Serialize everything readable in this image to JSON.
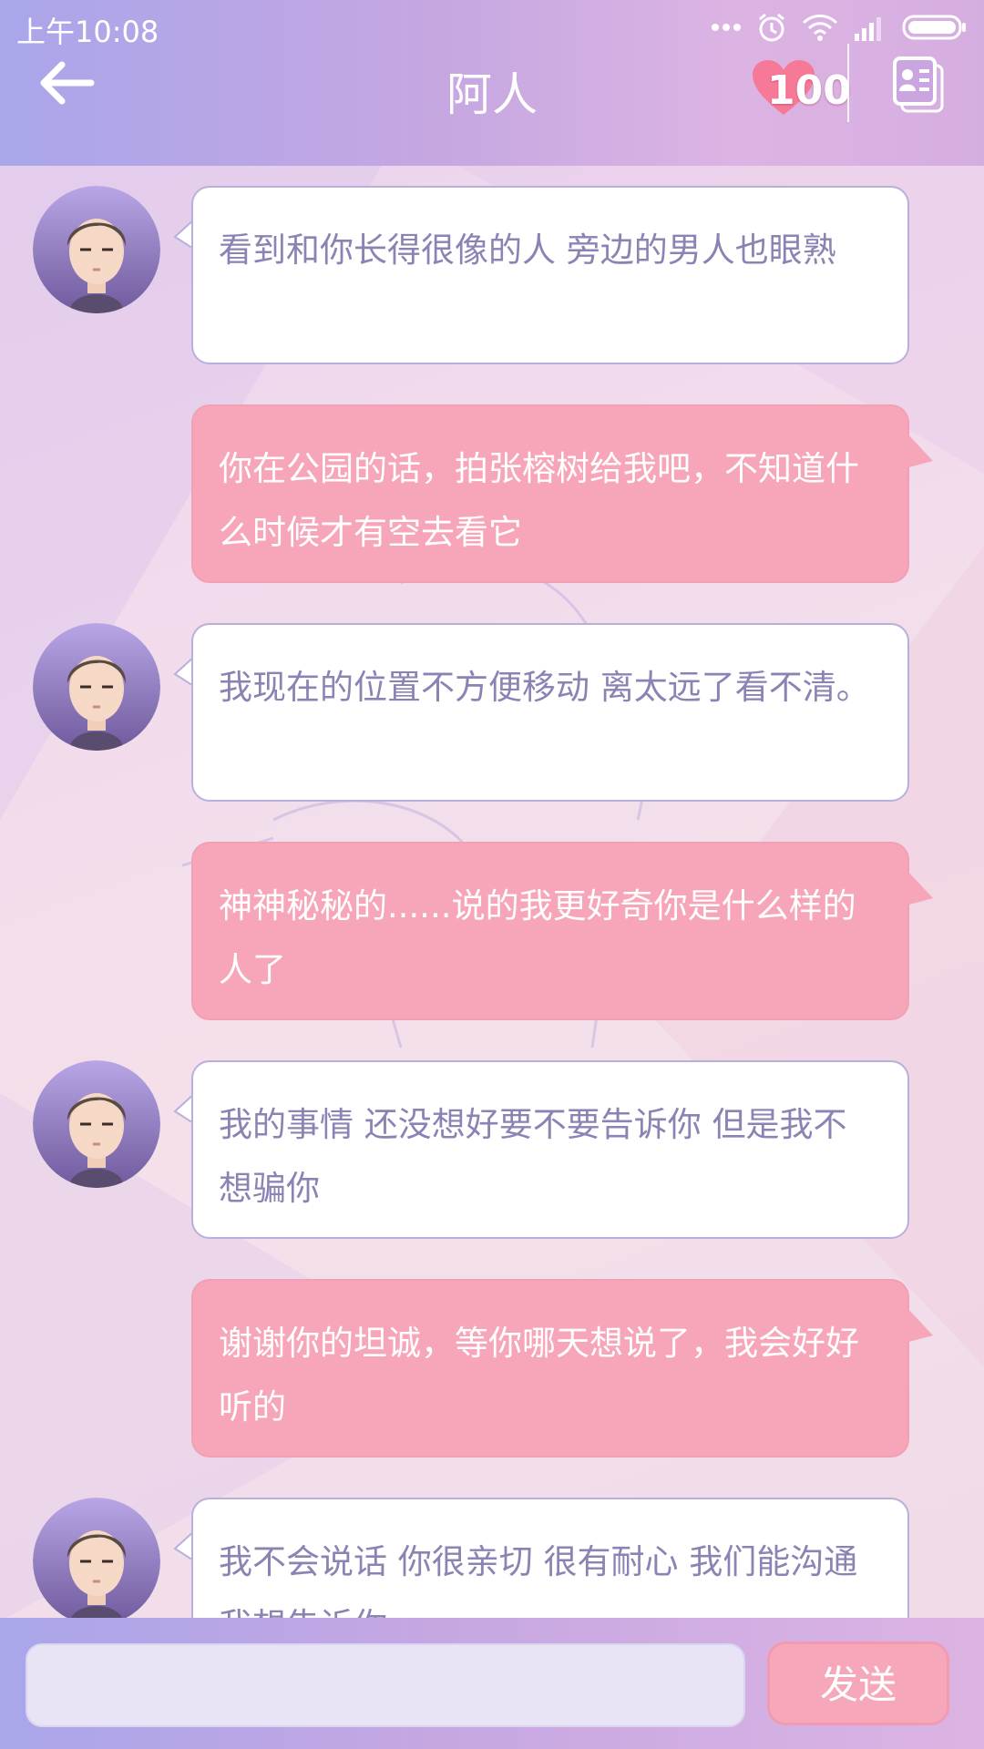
{
  "status_bar": {
    "time": "上午10:08",
    "icons": [
      "more-dots-icon",
      "alarm-icon",
      "wifi-icon",
      "signal-icon",
      "battery-icon"
    ]
  },
  "header": {
    "title": "阿人",
    "back_icon": "back-arrow-icon",
    "affection_count": "100",
    "profile_icon": "profile-card-icon"
  },
  "messages": [
    {
      "from": "contact",
      "text": "看到和你长得很像的人 旁边的男人也眼熟"
    },
    {
      "from": "me",
      "text": "你在公园的话，拍张榕树给我吧，不知道什么时候才有空去看它"
    },
    {
      "from": "contact",
      "text": "我现在的位置不方便移动 离太远了看不清。"
    },
    {
      "from": "me",
      "text": "神神秘秘的......说的我更好奇你是什么样的人了"
    },
    {
      "from": "contact",
      "text": "我的事情 还没想好要不要告诉你 但是我不想骗你"
    },
    {
      "from": "me",
      "text": "谢谢你的坦诚，等你哪天想说了，我会好好听的"
    },
    {
      "from": "contact",
      "text": "我不会说话 你很亲切 很有耐心 我们能沟通 我想告诉你"
    }
  ],
  "input": {
    "value": "",
    "send_label": "发送"
  },
  "colors": {
    "header_gradient_start": "#a9a6ea",
    "header_gradient_end": "#dcb4e3",
    "incoming_bubble": "#ffffff",
    "incoming_text": "#8a83b3",
    "outgoing_bubble": "#f7a6ba",
    "outgoing_text": "#ffffff",
    "send_button": "#f6a8ba"
  }
}
